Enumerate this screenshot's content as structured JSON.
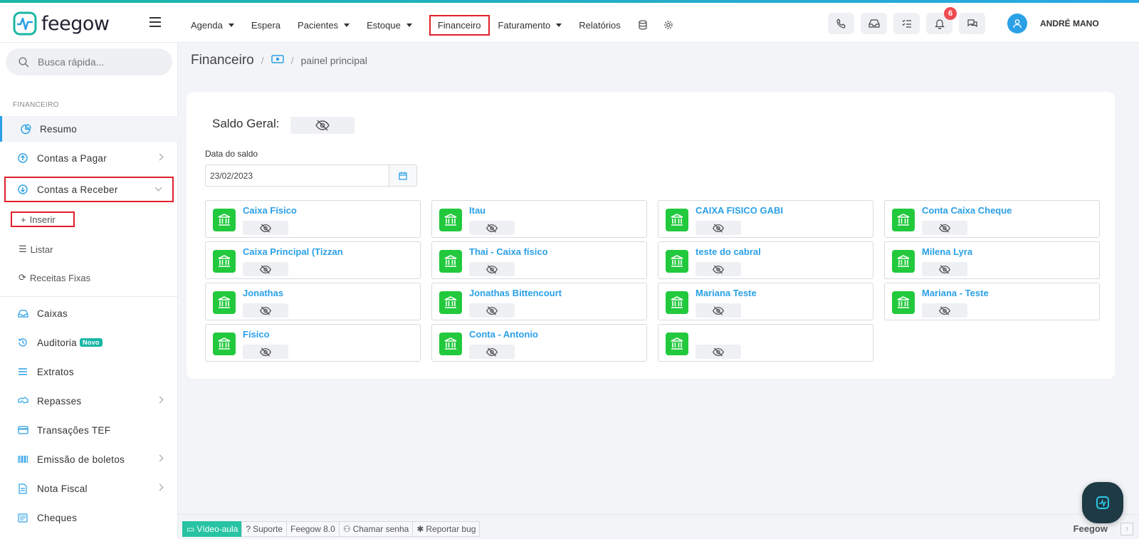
{
  "app": {
    "logo_text": "feegow",
    "colors": {
      "accent": "#2aa0e6",
      "green": "#22c93d",
      "teal": "#1ab7a6",
      "highlight": "#e0202a"
    }
  },
  "topnav": {
    "items": [
      {
        "label": "Agenda",
        "has_dropdown": true
      },
      {
        "label": "Espera",
        "has_dropdown": false
      },
      {
        "label": "Pacientes",
        "has_dropdown": true
      },
      {
        "label": "Estoque",
        "has_dropdown": true
      },
      {
        "label": "Financeiro",
        "has_dropdown": false,
        "highlighted": true
      },
      {
        "label": "Faturamento",
        "has_dropdown": true
      },
      {
        "label": "Relatórios",
        "has_dropdown": false
      }
    ],
    "icons": [
      "database-icon",
      "gear-icon"
    ]
  },
  "topright": {
    "buttons": [
      "phone-icon",
      "inbox-icon",
      "checklist-icon",
      "bell-icon",
      "chat-icon"
    ],
    "notification_count": "6",
    "user_name": "ANDRÉ MANO"
  },
  "sidebar": {
    "search_placeholder": "Busca rápida...",
    "section_label": "FINANCEIRO",
    "items": [
      {
        "label": "Resumo",
        "icon": "pie-chart-icon"
      },
      {
        "label": "Contas a Pagar",
        "icon": "arrow-up-circle-icon"
      },
      {
        "label": "Contas a Receber",
        "icon": "arrow-down-circle-icon"
      },
      {
        "label": "Caixas",
        "icon": "inbox-icon"
      },
      {
        "label": "Auditoria",
        "icon": "history-icon",
        "badge": "Novo"
      },
      {
        "label": "Extratos",
        "icon": "list-icon"
      },
      {
        "label": "Repasses",
        "icon": "handshake-icon"
      },
      {
        "label": "Transações TEF",
        "icon": "credit-card-icon"
      },
      {
        "label": "Emissão de boletos",
        "icon": "barcode-icon"
      },
      {
        "label": "Nota Fiscal",
        "icon": "document-icon"
      },
      {
        "label": "Cheques",
        "icon": "cheque-icon"
      }
    ],
    "subitems": [
      {
        "label": "Inserir",
        "icon": "plus-icon"
      },
      {
        "label": "Listar",
        "icon": "list-icon"
      },
      {
        "label": "Receitas Fixas",
        "icon": "refresh-icon"
      }
    ]
  },
  "breadcrumb": {
    "title": "Financeiro",
    "separator": "/",
    "current": "painel principal"
  },
  "panel": {
    "saldo_label": "Saldo Geral:",
    "data_label": "Data do saldo",
    "date_value": "23/02/2023",
    "accounts": [
      "Caixa Físico",
      "Itau",
      "CAIXA FISICO GABI",
      "Conta Caixa Cheque",
      "Caixa Principal (Tizzan",
      "Thai - Caixa físico",
      "teste do cabral",
      "Milena Lyra",
      "Jonathas",
      "Jonathas Bittencourt",
      "Mariana Teste",
      "Mariana - Teste",
      "Físico",
      "Conta - Antonio",
      ""
    ]
  },
  "bottombar": {
    "video": "Vídeo-aula",
    "suporte": "Suporte",
    "version": "Feegow 8.0",
    "chamar": "Chamar senha",
    "bug": "Reportar bug",
    "brand": "Feegow",
    "up_arrow": "↑"
  }
}
